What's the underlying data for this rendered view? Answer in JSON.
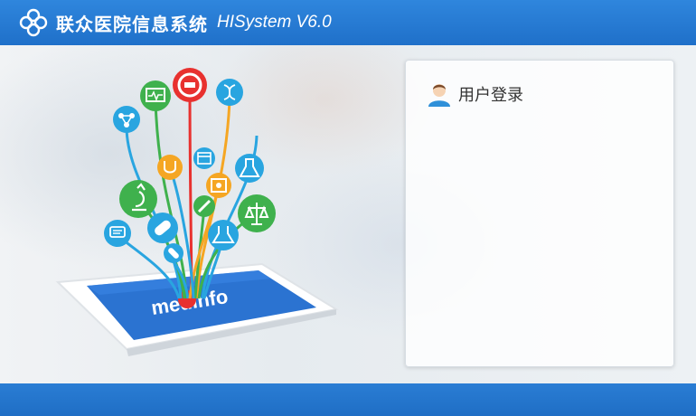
{
  "window": {
    "title_cn": "联众医院信息系统",
    "title_en": "HISystem V6.0"
  },
  "login": {
    "title": "用户登录"
  },
  "illustration": {
    "brand": "medinfo",
    "brand_colors": {
      "red": "#e8312f",
      "tablet_blue": "#2b73d1"
    }
  },
  "icons": [
    "logo-clover-icon",
    "user-avatar-icon",
    "medical-cross-icon",
    "monitor-icon",
    "dna-icon",
    "molecule-icon",
    "stethoscope-icon",
    "calendar-icon",
    "flask-icon",
    "microscope-icon",
    "certificate-icon",
    "syringe-icon",
    "scale-icon",
    "chat-icon",
    "pill-icon",
    "bandage-icon",
    "beaker-icon"
  ],
  "colors": {
    "titlebar": "#1f70c9",
    "footer": "#1f6ec5",
    "panel_bg": "#ffffff"
  }
}
